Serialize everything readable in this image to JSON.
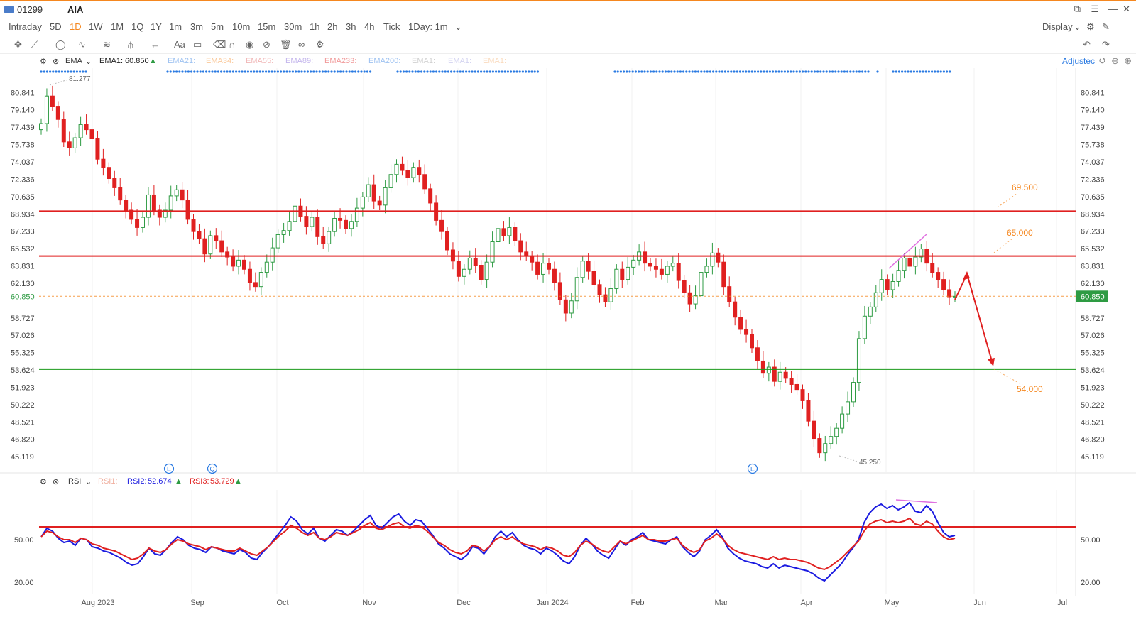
{
  "window": {
    "symbol_code": "01299",
    "symbol_name": "AIA"
  },
  "periods": {
    "items": [
      "Intraday",
      "5D",
      "1D",
      "1W",
      "1M",
      "1Q",
      "1Y",
      "1m",
      "3m",
      "5m",
      "10m",
      "15m",
      "30m",
      "1h",
      "2h",
      "3h",
      "4h",
      "Tick",
      "1Day: 1m"
    ],
    "active": "1D",
    "display_label": "Display"
  },
  "indicator": {
    "name": "EMA",
    "ema1_label": "EMA1:",
    "ema1_value": "60.850",
    "faded_items": [
      "EMA21:",
      "EMA34:",
      "EMA55:",
      "EMA89:",
      "EMA233:",
      "EMA200:",
      "EMA1:",
      "EMA1:",
      "EMA1:"
    ],
    "adjusted_label": "Adjustec"
  },
  "rsi": {
    "name": "RSI",
    "rsi1_label": "RSI1:",
    "rsi2_label": "RSI2:",
    "rsi2_value": "52.674",
    "rsi3_label": "RSI3:",
    "rsi3_value": "53.729",
    "levels": [
      "50.00",
      "20.00"
    ]
  },
  "colors": {
    "up": "#2e9b43",
    "down": "#e02020",
    "accent": "#f5871f",
    "resistance": "#e02020",
    "support": "#1a9a1a",
    "rsi2": "#1a1ae0",
    "rsi3": "#e02020"
  },
  "chart_data": {
    "type": "candlestick",
    "y_ticks": [
      "80.841",
      "79.140",
      "77.439",
      "75.738",
      "74.037",
      "72.336",
      "70.635",
      "68.934",
      "67.233",
      "65.532",
      "63.831",
      "62.130",
      "60.850",
      "58.727",
      "57.026",
      "55.325",
      "53.624",
      "51.923",
      "50.222",
      "48.521",
      "46.820",
      "45.119"
    ],
    "x_ticks": [
      "Aug 2023",
      "Sep",
      "Oct",
      "Nov",
      "Dec",
      "Jan 2024",
      "Feb",
      "Mar",
      "Apr",
      "May",
      "Jun",
      "Jul"
    ],
    "ylim": [
      44.5,
      81.7
    ],
    "last_price": "60.850",
    "high_label": "81.277",
    "low_label": "45.250",
    "resistance_lines": [
      69.2,
      64.8
    ],
    "support_lines": [
      53.7
    ],
    "targets": [
      "69.500",
      "65.000",
      "54.000"
    ],
    "event_markers": [
      "E",
      "Q",
      "E"
    ],
    "close_series": [
      77.8,
      80.5,
      79.5,
      78.2,
      76.0,
      75.4,
      76.4,
      77.7,
      77.2,
      76.3,
      74.3,
      73.5,
      72.4,
      71.5,
      70.3,
      69.3,
      68.4,
      67.6,
      68.6,
      70.8,
      69.3,
      68.6,
      69.3,
      70.7,
      71.3,
      70.3,
      68.4,
      67.2,
      66.5,
      65.0,
      66.8,
      66.3,
      65.2,
      64.7,
      63.8,
      64.4,
      63.5,
      62.2,
      61.8,
      63.2,
      64.2,
      65.6,
      66.9,
      67.3,
      68.2,
      69.7,
      68.7,
      67.7,
      68.6,
      66.7,
      66.0,
      67.2,
      68.5,
      68.3,
      67.5,
      68.2,
      69.5,
      70.6,
      71.8,
      70.2,
      69.8,
      71.5,
      72.8,
      73.8,
      73.2,
      72.5,
      73.5,
      72.8,
      71.4,
      70.0,
      68.3,
      67.2,
      65.4,
      64.3,
      62.8,
      63.5,
      64.6,
      63.9,
      62.5,
      64.2,
      66.2,
      67.5,
      66.8,
      67.6,
      66.3,
      65.2,
      64.8,
      64.2,
      63.0,
      64.1,
      63.5,
      62.2,
      60.5,
      59.2,
      60.4,
      62.7,
      64.3,
      63.3,
      62.0,
      61.0,
      60.3,
      61.6,
      63.5,
      62.5,
      63.7,
      64.4,
      65.2,
      64.1,
      63.8,
      63.5,
      63.0,
      63.8,
      64.1,
      62.4,
      61.2,
      60.1,
      60.9,
      63.2,
      63.8,
      65.1,
      64.2,
      61.8,
      60.3,
      58.8,
      57.6,
      57.1,
      55.8,
      54.5,
      53.3,
      53.9,
      52.5,
      53.4,
      52.8,
      52.2,
      51.7,
      50.6,
      48.6,
      46.9,
      45.5,
      46.4,
      47.1,
      47.9,
      49.3,
      50.5,
      52.4,
      56.7,
      58.9,
      59.8,
      61.2,
      62.5,
      61.5,
      62.3,
      63.4,
      64.6,
      63.8,
      64.7,
      65.5,
      64.1,
      63.2,
      62.5,
      61.5,
      60.8,
      60.85
    ],
    "rsi2_series": [
      52,
      58,
      56,
      51,
      48,
      49,
      46,
      51,
      50,
      45,
      44,
      42,
      41,
      39,
      37,
      34,
      32,
      33,
      38,
      44,
      40,
      39,
      43,
      48,
      52,
      50,
      46,
      44,
      43,
      41,
      45,
      44,
      42,
      41,
      40,
      43,
      41,
      37,
      36,
      41,
      45,
      50,
      55,
      60,
      66,
      63,
      57,
      54,
      58,
      51,
      49,
      53,
      57,
      56,
      53,
      56,
      60,
      64,
      67,
      60,
      58,
      62,
      66,
      68,
      63,
      60,
      64,
      63,
      58,
      53,
      47,
      44,
      40,
      38,
      36,
      39,
      45,
      44,
      40,
      45,
      52,
      56,
      52,
      55,
      50,
      46,
      44,
      43,
      40,
      44,
      42,
      39,
      35,
      33,
      38,
      46,
      51,
      47,
      42,
      39,
      37,
      43,
      49,
      46,
      50,
      52,
      55,
      50,
      49,
      48,
      47,
      50,
      52,
      45,
      41,
      38,
      42,
      50,
      53,
      57,
      52,
      44,
      40,
      37,
      35,
      34,
      33,
      31,
      30,
      33,
      30,
      32,
      31,
      30,
      29,
      28,
      26,
      23,
      21,
      25,
      29,
      33,
      39,
      44,
      50,
      62,
      69,
      73,
      75,
      72,
      74,
      71,
      73,
      76,
      70,
      69,
      74,
      70,
      62,
      55,
      52,
      53
    ],
    "rsi3_series": [
      52,
      56,
      55,
      52,
      50,
      50,
      48,
      51,
      50,
      47,
      46,
      44,
      43,
      42,
      40,
      38,
      36,
      37,
      40,
      44,
      42,
      41,
      43,
      47,
      50,
      49,
      47,
      46,
      45,
      43,
      45,
      44,
      43,
      42,
      42,
      44,
      42,
      40,
      39,
      42,
      45,
      49,
      53,
      56,
      60,
      58,
      55,
      53,
      55,
      51,
      50,
      52,
      55,
      54,
      53,
      55,
      57,
      60,
      62,
      58,
      57,
      59,
      61,
      62,
      59,
      58,
      60,
      59,
      56,
      52,
      48,
      46,
      43,
      41,
      40,
      42,
      46,
      45,
      42,
      45,
      50,
      52,
      50,
      52,
      49,
      47,
      46,
      45,
      43,
      45,
      44,
      42,
      39,
      38,
      41,
      46,
      49,
      47,
      44,
      42,
      41,
      45,
      49,
      47,
      49,
      51,
      53,
      50,
      50,
      49,
      49,
      50,
      51,
      46,
      43,
      41,
      43,
      49,
      51,
      54,
      51,
      46,
      43,
      41,
      40,
      39,
      38,
      37,
      36,
      38,
      36,
      37,
      36,
      36,
      35,
      34,
      32,
      30,
      29,
      31,
      34,
      37,
      41,
      45,
      49,
      56,
      61,
      63,
      64,
      62,
      63,
      62,
      63,
      65,
      61,
      60,
      63,
      61,
      56,
      52,
      50,
      51
    ]
  }
}
